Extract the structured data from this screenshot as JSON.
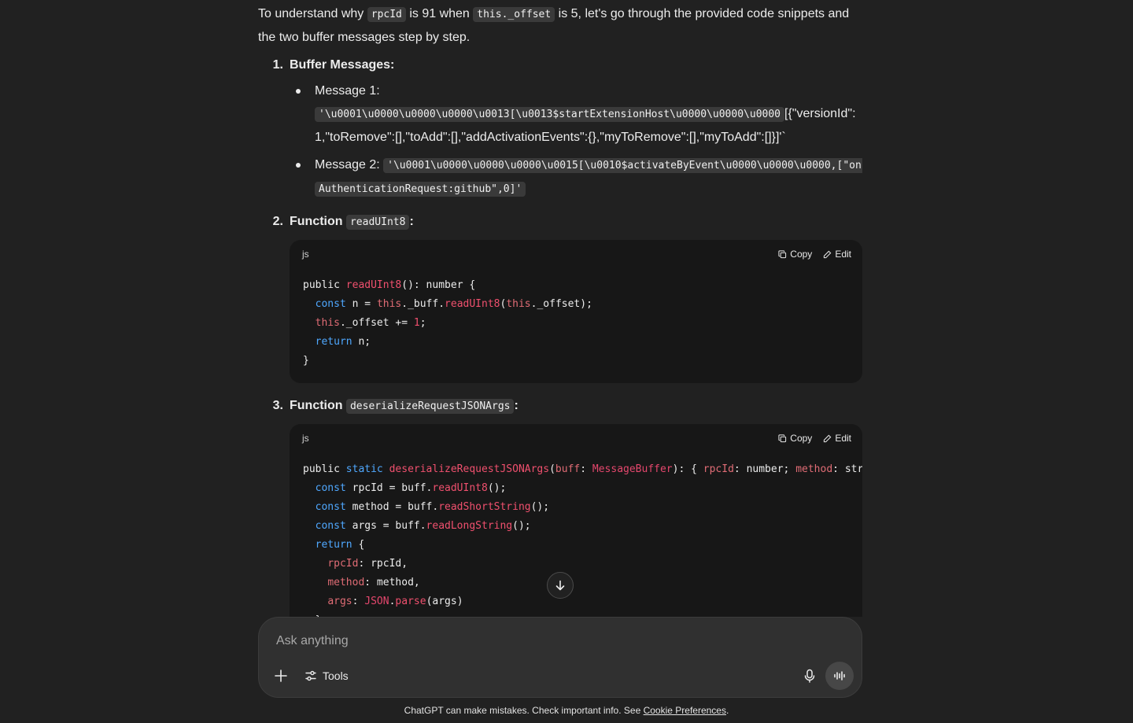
{
  "intro": {
    "t1": "To understand why ",
    "c1": "rpcId",
    "t2": " is 91 when ",
    "c2": "this._offset",
    "t3": " is 5, let's go through the provided code snippets and the two buffer messages step by step."
  },
  "section1": {
    "num": "1.",
    "title": "Buffer Messages:",
    "msg1_label": "Message 1:",
    "msg1_code": "'\\u0001\\u0000\\u0000\\u0000\\u0013[\\u0013$startExtensionHost\\u0000\\u0000\\u0000",
    "msg1_rest": "[{\"versionId\":1,\"toRemove\":[],\"toAdd\":[],\"addActivationEvents\":{},\"myToRemove\":[],\"myToAdd\":[]}]'`",
    "msg2_label": "Message 2: ",
    "msg2_code": "'\\u0001\\u0000\\u0000\\u0000\\u0015[\\u0010$activateByEvent\\u0000\\u0000\\u0000,[\"onAuthenticationRequest:github\",0]'"
  },
  "section2": {
    "num": "2.",
    "title_prefix": "Function ",
    "title_code": "readUInt8",
    "title_suffix": ":"
  },
  "section3": {
    "num": "3.",
    "title_prefix": "Function ",
    "title_code": "deserializeRequestJSONArgs",
    "title_suffix": ":"
  },
  "codeblock1": {
    "lang": "js",
    "copy": "Copy",
    "edit": "Edit"
  },
  "codeblock2": {
    "lang": "js",
    "copy": "Copy",
    "edit": "Edit"
  },
  "composer": {
    "placeholder": "Ask anything",
    "tools": "Tools"
  },
  "footer": {
    "text": "ChatGPT can make mistakes. Check important info. See ",
    "link": "Cookie Preferences",
    "end": "."
  },
  "icons": [
    "copy-icon",
    "edit-icon",
    "arrow-down-icon",
    "plus-icon",
    "tools-icon",
    "mic-icon",
    "voice-mode-icon"
  ]
}
